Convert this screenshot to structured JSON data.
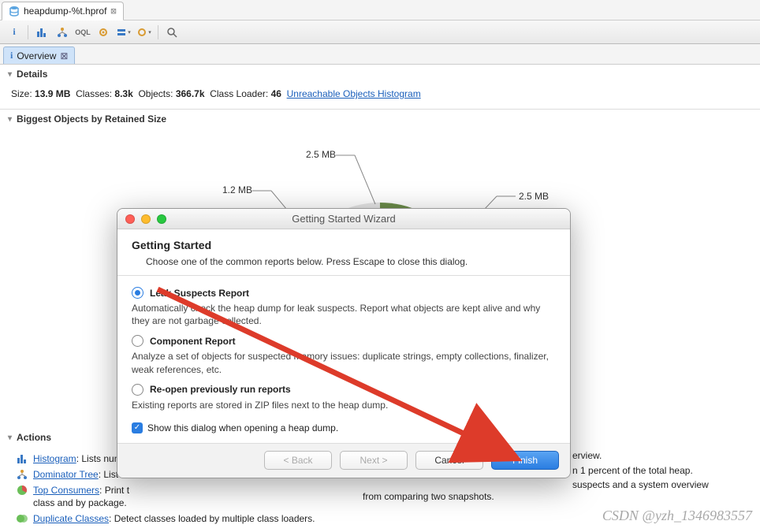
{
  "tab": {
    "title": "heapdump-%t.hprof"
  },
  "subtab": {
    "label": "Overview"
  },
  "sections": {
    "details": "Details",
    "biggest": "Biggest Objects by Retained Size",
    "actions": "Actions"
  },
  "details": {
    "size_k": "Size:",
    "size_v": "13.9 MB",
    "classes_k": "Classes:",
    "classes_v": "8.3k",
    "objects_k": "Objects:",
    "objects_v": "366.7k",
    "classloader_k": "Class Loader:",
    "classloader_v": "46",
    "link": "Unreachable Objects Histogram"
  },
  "chart_data": {
    "type": "pie",
    "title": "",
    "series": [
      {
        "name": "slice-a",
        "value": 2.5,
        "label": "2.5 MB",
        "color": "#5b8b8b"
      },
      {
        "name": "slice-b",
        "value": 2.5,
        "label": "2.5 MB",
        "color": "#4f7777"
      },
      {
        "name": "remainder",
        "value": 7.7,
        "label": "",
        "color": "#e5e5e5"
      },
      {
        "name": "slice-c",
        "value": 1.2,
        "label": "1.2 MB",
        "color": "#6b8c4a"
      }
    ],
    "total": 13.9
  },
  "actions": {
    "histogram": {
      "name": "Histogram",
      "desc": ": Lists numb"
    },
    "dominator": {
      "name": "Dominator Tree",
      "desc": ": List th"
    },
    "topcons": {
      "name": "Top Consumers",
      "desc_a": ": Print t",
      "desc_b": "class and by package."
    },
    "dupes": {
      "name": "Duplicate Classes",
      "desc": ": Detect classes loaded by multiple class loaders."
    },
    "right1": "erview.",
    "right2": "n 1 percent of the total heap.",
    "right3": "suspects and a system overview",
    "right4": "from comparing two snapshots."
  },
  "dialog": {
    "title": "Getting Started Wizard",
    "heading": "Getting Started",
    "sub": "Choose one of the common reports below. Press Escape to close this dialog.",
    "opt1": {
      "label": "Leak Suspects Report",
      "desc": "Automatically check the heap dump for leak suspects. Report what objects are kept alive and why they are not garbage collected."
    },
    "opt2": {
      "label": "Component Report",
      "desc": "Analyze a set of objects for suspected memory issues: duplicate strings, empty collections, finalizer, weak references, etc."
    },
    "opt3": {
      "label": "Re-open previously run reports",
      "desc": "Existing reports are stored in ZIP files next to the heap dump."
    },
    "showchk": "Show this dialog when opening a heap dump.",
    "back": "< Back",
    "next": "Next >",
    "cancel": "Cancel",
    "finish": "Finish"
  },
  "watermark": "CSDN @yzh_1346983557"
}
